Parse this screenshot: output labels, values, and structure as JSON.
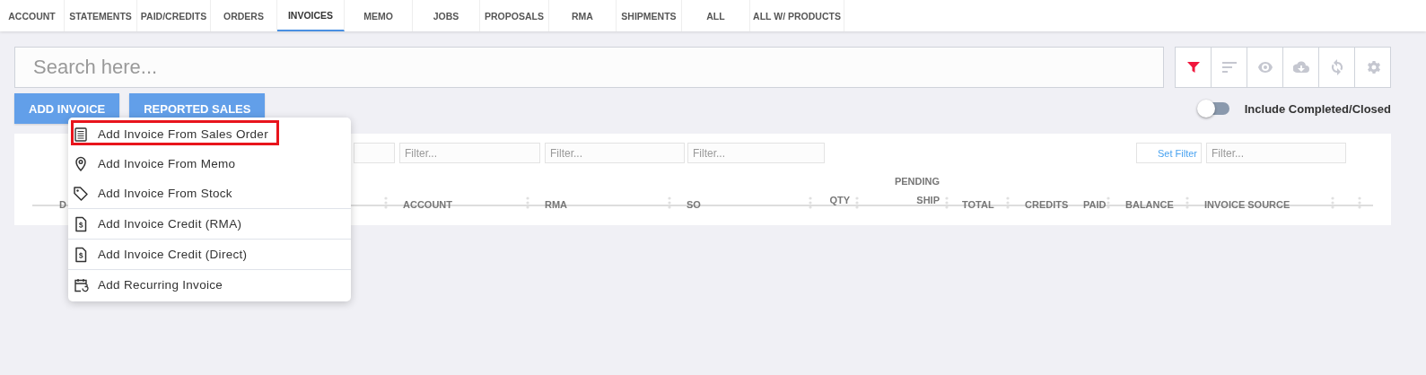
{
  "tabs": [
    {
      "label": "ACCOUNT",
      "selected": false
    },
    {
      "label": "STATEMENTS",
      "selected": false
    },
    {
      "label": "PAID/CREDITS",
      "selected": false
    },
    {
      "label": "ORDERS",
      "selected": false
    },
    {
      "label": "INVOICES",
      "selected": true
    },
    {
      "label": "MEMO",
      "selected": false
    },
    {
      "label": "JOBS",
      "selected": false
    },
    {
      "label": "PROPOSALS",
      "selected": false
    },
    {
      "label": "RMA",
      "selected": false
    },
    {
      "label": "SHIPMENTS",
      "selected": false
    },
    {
      "label": "ALL",
      "selected": false
    },
    {
      "label": "ALL W/ PRODUCTS",
      "selected": false
    }
  ],
  "search": {
    "placeholder": "Search here..."
  },
  "toolbar": [
    {
      "kind": "filter",
      "active": true
    },
    {
      "kind": "sort",
      "active": false
    },
    {
      "kind": "view",
      "active": false
    },
    {
      "kind": "download",
      "active": false
    },
    {
      "kind": "refresh",
      "active": false
    },
    {
      "kind": "settings",
      "active": false
    }
  ],
  "actions": [
    "ADD INVOICE",
    "REPORTED SALES"
  ],
  "include_toggle": {
    "label": "Include Completed/Closed",
    "on": false
  },
  "filters": [
    {
      "kind": "field"
    },
    {
      "kind": "field",
      "placeholder": "Filter..."
    },
    {
      "kind": "field",
      "placeholder": "Filter..."
    },
    {
      "kind": "field",
      "placeholder": "Filter..."
    },
    {
      "kind": "set_filter",
      "label": "Set Filter"
    },
    {
      "kind": "field",
      "placeholder": "Filter..."
    }
  ],
  "table": {
    "columns": [
      {
        "label": "D"
      },
      {
        "label": "ACCOUNT"
      },
      {
        "label": "RMA"
      },
      {
        "label": "SO"
      },
      {
        "label": "QTY"
      },
      {
        "label": "PENDING SHIP"
      },
      {
        "label": "TOTAL"
      },
      {
        "label": "CREDITS"
      },
      {
        "label": "PAID"
      },
      {
        "label": "BALANCE"
      },
      {
        "label": "INVOICE SOURCE"
      },
      {}
    ]
  },
  "menu": {
    "items": [
      {
        "label": "Add Invoice From Sales Order",
        "highlighted": true,
        "divider": false
      },
      {
        "label": "Add Invoice From Memo",
        "highlighted": false,
        "divider": false
      },
      {
        "label": "Add Invoice From Stock",
        "highlighted": false,
        "divider": false
      },
      {
        "label": "Add Invoice Credit (RMA)",
        "highlighted": false,
        "divider": true
      },
      {
        "label": "Add Invoice Credit (Direct)",
        "highlighted": false,
        "divider": true
      },
      {
        "label": "Add Recurring Invoice",
        "highlighted": false,
        "divider": true
      }
    ]
  }
}
